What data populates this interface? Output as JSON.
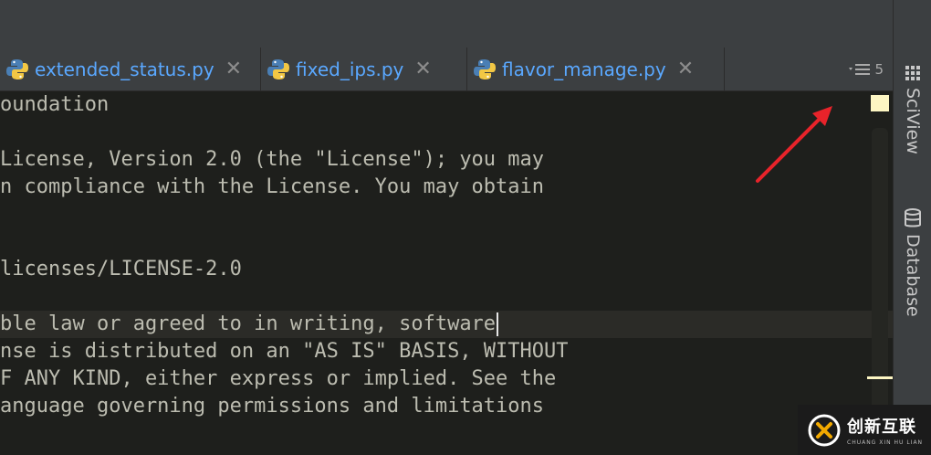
{
  "tabs": [
    {
      "label": "extended_status.py",
      "close": "✕"
    },
    {
      "label": "fixed_ips.py",
      "close": "✕"
    },
    {
      "label": "flavor_manage.py",
      "close": "✕"
    }
  ],
  "tab_count": "5",
  "editor_lines": [
    "oundation",
    "",
    "License, Version 2.0 (the \"License\"); you may",
    "n compliance with the License. You may obtain",
    "",
    "",
    "licenses/LICENSE-2.0",
    "",
    "ble law or agreed to in writing, software",
    "nse is distributed on an \"AS IS\" BASIS, WITHOUT",
    "F ANY KIND, either express or implied. See the",
    "anguage governing permissions and limitations"
  ],
  "sidebar": {
    "sciview": "SciView",
    "database": "Database"
  },
  "watermark": {
    "main": "创新互联",
    "sub": "CHUANG XIN HU LIAN"
  },
  "colors": {
    "tab_text": "#5aa8ff",
    "marker": "#fdf6c3",
    "arrow": "#e8232a"
  }
}
